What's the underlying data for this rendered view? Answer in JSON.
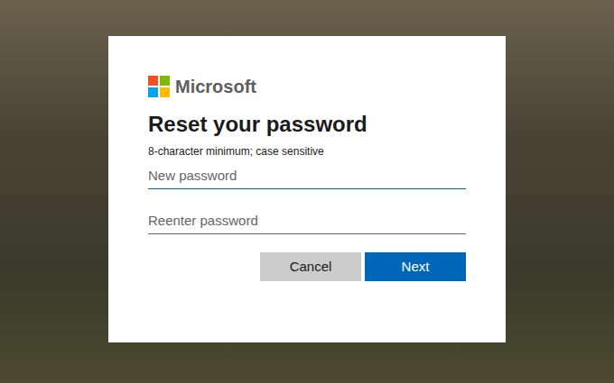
{
  "brand": {
    "name": "Microsoft"
  },
  "dialog": {
    "title": "Reset your password",
    "hint": "8-character minimum; case sensitive"
  },
  "fields": [
    {
      "placeholder": "New password",
      "focused": true
    },
    {
      "placeholder": "Reenter password",
      "focused": false
    }
  ],
  "buttons": [
    {
      "label": "Cancel",
      "kind": "secondary"
    },
    {
      "label": "Next",
      "kind": "primary"
    }
  ]
}
